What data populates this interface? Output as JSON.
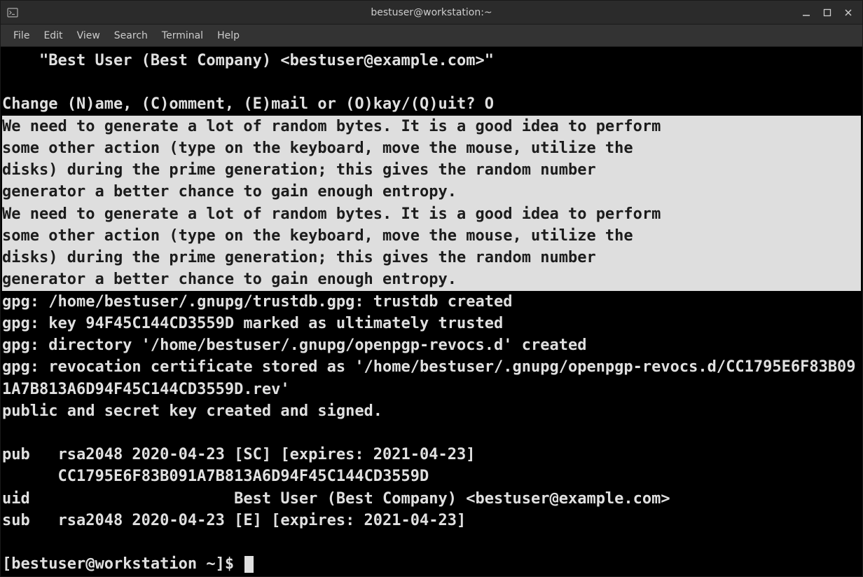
{
  "titlebar": {
    "title": "bestuser@workstation:~"
  },
  "menubar": {
    "items": [
      "File",
      "Edit",
      "View",
      "Search",
      "Terminal",
      "Help"
    ]
  },
  "terminal": {
    "line_uid_selected": "    \"Best User (Best Company) <bestuser@example.com>\"",
    "line_change_prompt": "Change (N)ame, (C)omment, (E)mail or (O)kay/(Q)uit? O",
    "highlighted_block": "We need to generate a lot of random bytes. It is a good idea to perform\nsome other action (type on the keyboard, move the mouse, utilize the\ndisks) during the prime generation; this gives the random number\ngenerator a better chance to gain enough entropy.\nWe need to generate a lot of random bytes. It is a good idea to perform\nsome other action (type on the keyboard, move the mouse, utilize the\ndisks) during the prime generation; this gives the random number\ngenerator a better chance to gain enough entropy.",
    "line_trustdb": "gpg: /home/bestuser/.gnupg/trustdb.gpg: trustdb created",
    "line_keymarked": "gpg: key 94F45C144CD3559D marked as ultimately trusted",
    "line_dircreated": "gpg: directory '/home/bestuser/.gnupg/openpgp-revocs.d' created",
    "line_revoc": "gpg: revocation certificate stored as '/home/bestuser/.gnupg/openpgp-revocs.d/CC1795E6F83B091A7B813A6D94F45C144CD3559D.rev'",
    "line_pubsecret": "public and secret key created and signed.",
    "line_pub": "pub   rsa2048 2020-04-23 [SC] [expires: 2021-04-23]",
    "line_fingerprint": "      CC1795E6F83B091A7B813A6D94F45C144CD3559D",
    "line_uid": "uid                      Best User (Best Company) <bestuser@example.com>",
    "line_sub": "sub   rsa2048 2020-04-23 [E] [expires: 2021-04-23]",
    "prompt": "[bestuser@workstation ~]$ "
  }
}
